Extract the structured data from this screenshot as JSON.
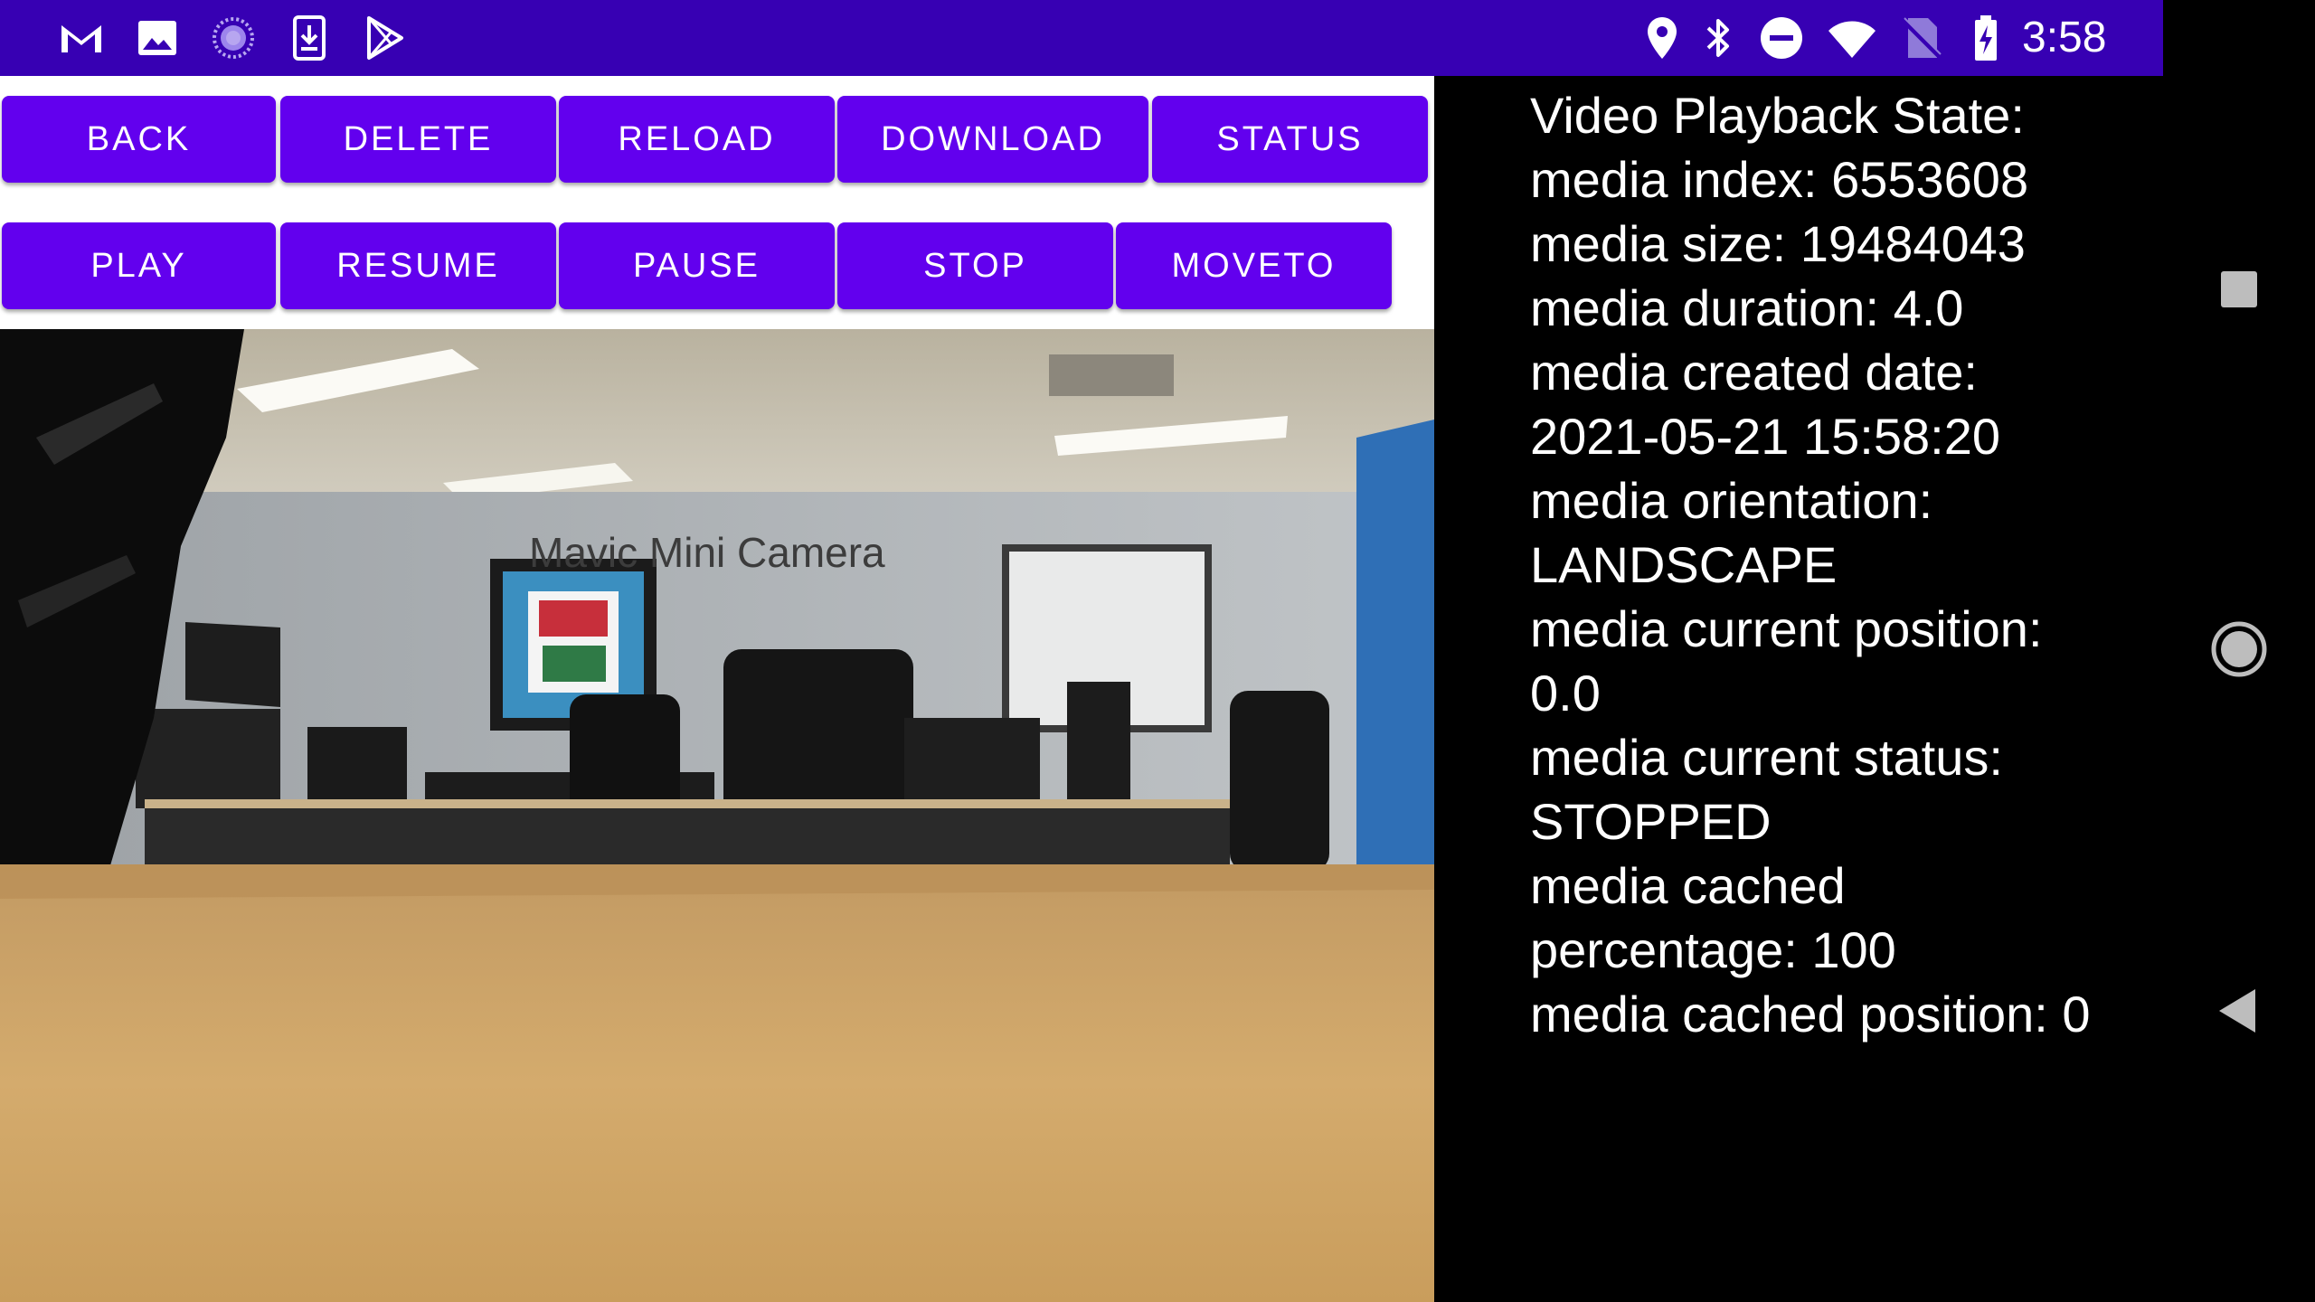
{
  "status_bar": {
    "time": "3:58",
    "left_icons": [
      "gmail-icon",
      "gallery-icon",
      "sync-icon",
      "download-icon",
      "play-store-icon"
    ],
    "right_icons": [
      "location-icon",
      "bluetooth-icon",
      "do-not-disturb-icon",
      "wifi-icon",
      "no-sim-icon",
      "battery-charging-icon"
    ],
    "background_color": "#3700b3"
  },
  "toolbar": {
    "row1": [
      {
        "label": "BACK"
      },
      {
        "label": "DELETE"
      },
      {
        "label": "RELOAD"
      },
      {
        "label": "DOWNLOAD"
      },
      {
        "label": "STATUS"
      }
    ],
    "row2": [
      {
        "label": "PLAY"
      },
      {
        "label": "RESUME"
      },
      {
        "label": "PAUSE"
      },
      {
        "label": "STOP"
      },
      {
        "label": "MOVETO"
      }
    ],
    "button_color": "#6200ee"
  },
  "camera": {
    "label": "Mavic Mini Camera"
  },
  "playback_info": {
    "lines": [
      "Video Playback State:",
      "media index: 6553608",
      "media size: 19484043",
      "media duration: 4.0",
      "media created date:",
      "2021-05-21 15:58:20",
      "media orientation:",
      "LANDSCAPE",
      "media current position:",
      "0.0",
      "media current status:",
      "STOPPED",
      "media cached",
      "percentage: 100",
      "media cached position: 0"
    ]
  },
  "nav_bar": {
    "buttons": [
      "recents-button",
      "home-button",
      "back-button"
    ]
  }
}
